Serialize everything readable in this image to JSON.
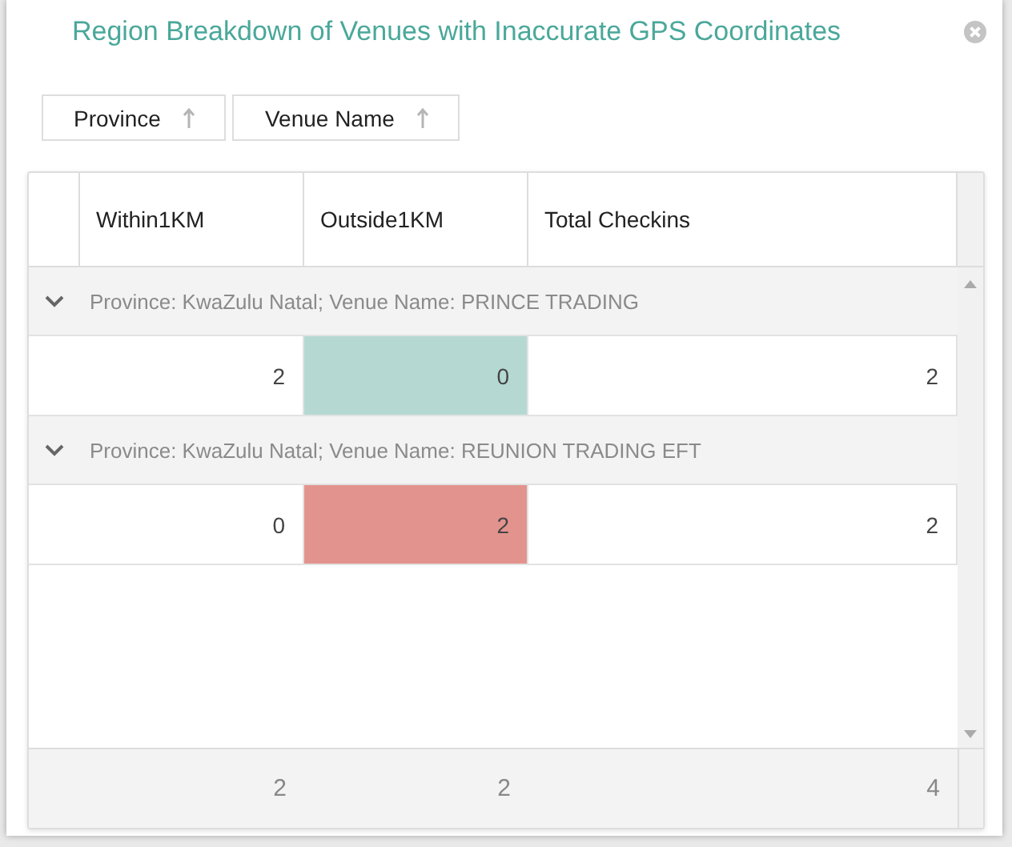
{
  "dialog": {
    "title": "Region Breakdown of Venues with Inaccurate GPS Coordinates"
  },
  "group_by": [
    {
      "label": "Province"
    },
    {
      "label": "Venue Name"
    }
  ],
  "table": {
    "columns": [
      "Within1KM",
      "Outside1KM",
      "Total Checkins"
    ],
    "groups": [
      {
        "label": "Province: KwaZulu Natal; Venue Name: PRINCE TRADING",
        "expanded": true,
        "cells": [
          {
            "value": "2"
          },
          {
            "value": "0",
            "color": "#b5d9d2"
          },
          {
            "value": "2"
          }
        ]
      },
      {
        "label": "Province: KwaZulu Natal; Venue Name: REUNION TRADING EFT",
        "expanded": true,
        "cells": [
          {
            "value": "0"
          },
          {
            "value": "2",
            "color": "#e3938e"
          },
          {
            "value": "2"
          }
        ]
      }
    ],
    "totals": [
      "2",
      "2",
      "4"
    ]
  }
}
